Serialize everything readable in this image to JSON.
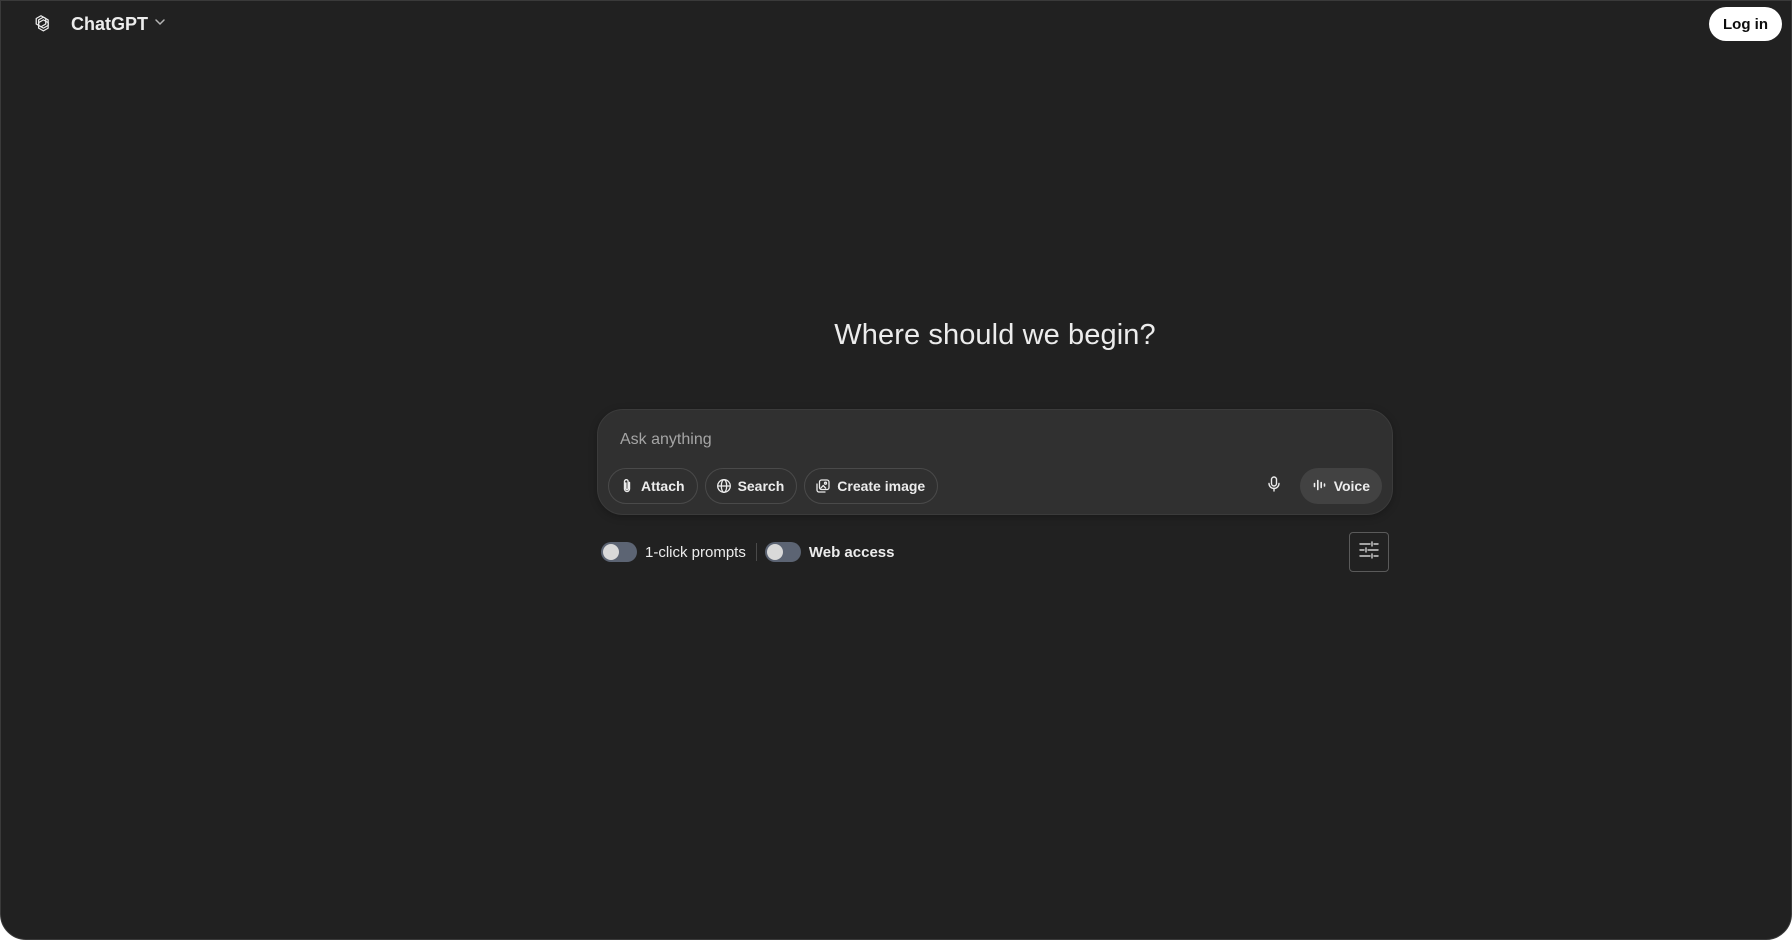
{
  "header": {
    "logo_icon": "openai-logo-icon",
    "model_name": "ChatGPT",
    "model_chevron_icon": "chevron-down-icon",
    "login_label": "Log in"
  },
  "main": {
    "headline": "Where should we begin?",
    "composer": {
      "placeholder": "Ask anything",
      "value": "",
      "tools": [
        {
          "label": "Attach",
          "icon": "paperclip-icon"
        },
        {
          "label": "Search",
          "icon": "globe-icon"
        },
        {
          "label": "Create image",
          "icon": "image-icon"
        }
      ],
      "mic_icon": "microphone-icon",
      "voice_label": "Voice",
      "voice_icon": "voice-waveform-icon"
    }
  },
  "extension_bar": {
    "toggles": [
      {
        "label": "1-click prompts",
        "enabled": false
      },
      {
        "label": "Web access",
        "enabled": false
      }
    ],
    "settings_icon": "sliders-icon"
  },
  "colors": {
    "background": "#212121",
    "composer": "#303030",
    "text": "#ececec",
    "toggle_off": "#5c6473"
  }
}
